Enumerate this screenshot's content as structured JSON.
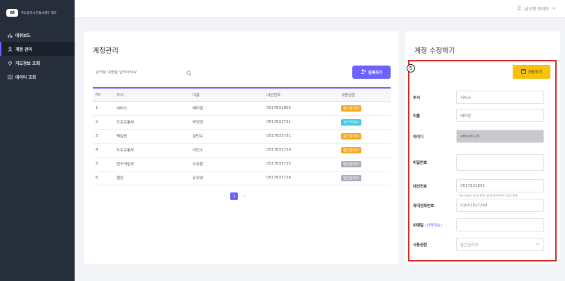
{
  "app": {
    "logo_mark": "ai",
    "logo_text": "주요광역시 전통보행구 제도"
  },
  "sidebar": {
    "items": [
      {
        "label": "대쉬보드",
        "icon": "bar-chart-icon"
      },
      {
        "label": "계정 관리",
        "icon": "user-icon",
        "active": true
      },
      {
        "label": "지도정보 조회",
        "icon": "map-pin-icon"
      },
      {
        "label": "데이터 조회",
        "icon": "table-icon"
      }
    ]
  },
  "header": {
    "user_label": "남구청 관리자"
  },
  "account_list": {
    "title": "계정관리",
    "search_placeholder": "검색할 내용을 입력하세요",
    "register_label": "등록하기",
    "columns": [
      "No",
      "부서",
      "이름",
      "내선번호",
      "사용권한"
    ],
    "rows": [
      {
        "no": "1",
        "dept": "서비스",
        "name": "배미림",
        "ext": "0517831805",
        "role": "중간관리자",
        "color": "#f5a623"
      },
      {
        "no": "2",
        "dept": "도로교통부",
        "name": "박정민",
        "ext": "0517833731",
        "role": "관리책임자",
        "color": "#3cc6e0"
      },
      {
        "no": "3",
        "dept": "팩일빈",
        "name": "김민수",
        "ext": "0517833731",
        "role": "중간관리자",
        "color": "#f5a623"
      },
      {
        "no": "4",
        "dept": "도로교통부",
        "name": "이민수",
        "ext": "0517833730",
        "role": "중간관리자",
        "color": "#f5a623"
      },
      {
        "no": "5",
        "dept": "연구개발부",
        "name": "오승환",
        "ext": "0517833735",
        "role": "일반관리자",
        "color": "#a9adb8"
      },
      {
        "no": "6",
        "dept": "행정",
        "name": "유성경",
        "ext": "0517833736",
        "role": "일반관리자",
        "color": "#a9adb8"
      }
    ],
    "pagination": {
      "prev": "‹",
      "current": "1",
      "next": "›"
    }
  },
  "edit_form": {
    "title": "계정 수정하기",
    "step_marker": "5",
    "save_label": "저장하기",
    "fields": {
      "dept": {
        "label": "부서",
        "value": "서비스"
      },
      "name": {
        "label": "이름",
        "value": "배미랑"
      },
      "id": {
        "label": "아이디",
        "value": "affka0126"
      },
      "password": {
        "label": "비밀번호",
        "value": "",
        "hint": "* 8~20자 이내 영문,숫자,특수문자 입력 필수"
      },
      "ext": {
        "label": "내선번호",
        "value": "0517831805"
      },
      "mobile": {
        "label": "휴대전화번호",
        "value": "01051827249"
      },
      "email": {
        "label": "이메일",
        "optional": "(선택정보)",
        "value": ""
      },
      "role": {
        "label": "사용권한",
        "value": "중간관리자"
      }
    }
  },
  "colors": {
    "sidebar_bg": "#262d3b",
    "accent": "#6c63ff",
    "save_button": "#f9c10e",
    "highlight_frame": "#d8261f"
  }
}
